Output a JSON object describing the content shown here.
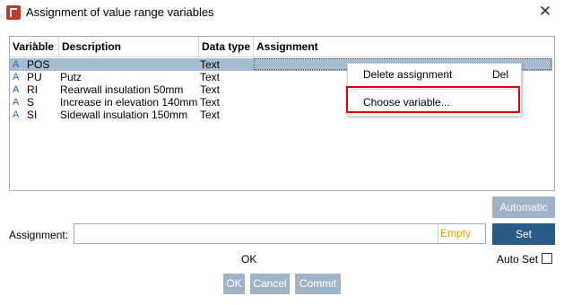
{
  "window": {
    "title": "Assignment of value range variables"
  },
  "table": {
    "columns": [
      "Variable",
      "Description",
      "Data type",
      "Assignment"
    ],
    "rows": [
      {
        "variable": "POS",
        "description": "",
        "data_type": "Text",
        "assignment": ""
      },
      {
        "variable": "PU",
        "description": "Putz",
        "data_type": "Text",
        "assignment": ""
      },
      {
        "variable": "RI",
        "description": "Rearwall insulation 50mm",
        "data_type": "Text",
        "assignment": ""
      },
      {
        "variable": "S",
        "description": "Increase in elevation 140mm",
        "data_type": "Text",
        "assignment": ""
      },
      {
        "variable": "SI",
        "description": "Sidewall insulation 150mm",
        "data_type": "Text",
        "assignment": ""
      }
    ],
    "selected_row": 0
  },
  "context_menu": {
    "items": [
      {
        "label": "Delete assignment",
        "shortcut": "Del"
      },
      {
        "label": "Choose variable...",
        "shortcut": ""
      }
    ]
  },
  "buttons": {
    "automatic": "Automatic",
    "set": "Set",
    "ok": "OK",
    "cancel": "Cancel",
    "commit": "Commit"
  },
  "assignment": {
    "label": "Assignment:",
    "value": "",
    "empty_hint": "Empty"
  },
  "status_text": "OK",
  "auto_set": {
    "label": "Auto Set",
    "checked": false
  },
  "colors": {
    "selection": "#a8bcd0",
    "button_light": "#9fb4c7",
    "button_dark": "#2a5a86",
    "highlight": "#e00000",
    "empty_hint": "#e8a000"
  }
}
